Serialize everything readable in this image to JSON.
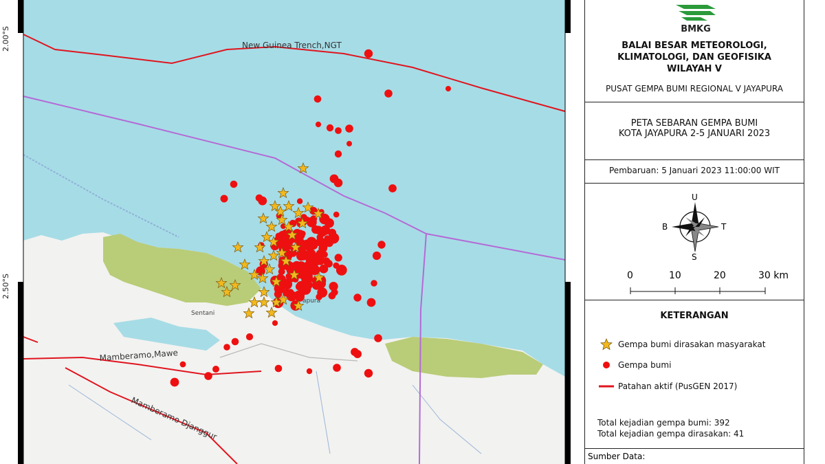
{
  "map": {
    "lat_labels": [
      "2.00°S",
      "2.50°S"
    ],
    "features": {
      "trench": "New Guinea Trench,NGT",
      "fault_1": "Mamberamo,Mawe",
      "fault_2": "Mamberamo Djanggur",
      "town_1": "Sentani",
      "town_2": "apura"
    },
    "colors": {
      "sea": "#a6dce6",
      "land": "#f2f2f0",
      "forest": "#b9cc78",
      "fault": "#e0141e",
      "plate": "#b46ad6",
      "quake": "#ee1010",
      "felt": "#f2b81e"
    }
  },
  "logo": {
    "text": "BMKG"
  },
  "org": {
    "line1": "BALAI BESAR METEOROLOGI,",
    "line2": "KLIMATOLOGI, DAN GEOFISIKA",
    "line3": "WILAYAH V",
    "subtitle": "PUSAT GEMPA BUMI REGIONAL V JAYAPURA"
  },
  "map_title": {
    "line1": "PETA SEBARAN GEMPA BUMI",
    "line2": "KOTA JAYAPURA 2-5 JANUARI 2023"
  },
  "update": "Pembaruan: 5 Januari 2023  11:00:00 WIT",
  "compass": {
    "north": "U",
    "south": "S",
    "east": "T",
    "west": "B"
  },
  "scale": {
    "ticks": [
      "0",
      "10",
      "20",
      "30 km"
    ]
  },
  "legend": {
    "heading": "KETERANGAN",
    "felt": "Gempa bumi dirasakan masyarakat",
    "quake": "Gempa bumi",
    "fault": "Patahan aktif (PusGEN 2017)"
  },
  "stats": {
    "total_quakes": "Total kejadian gempa bumi: 392",
    "total_felt": "Total kejadian gempa dirasakan: 41"
  },
  "source": {
    "label": "Sumber Data:"
  }
}
